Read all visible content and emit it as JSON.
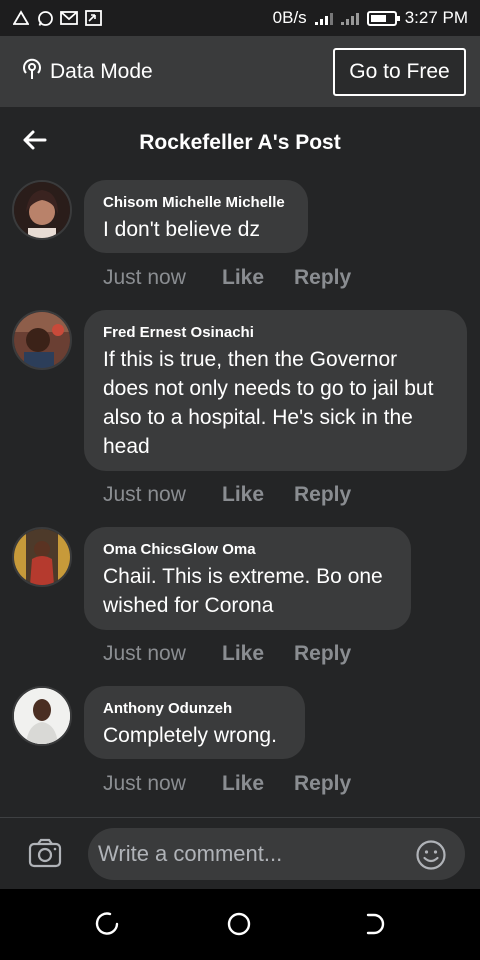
{
  "status_bar": {
    "speed": "0B/s",
    "time": "3:27 PM",
    "battery_level": 0.7,
    "icons": [
      "alert-icon",
      "whatsapp-icon",
      "gmail-icon",
      "screenshot-icon",
      "signal-icon",
      "battery-icon"
    ]
  },
  "data_bar": {
    "label": "Data Mode",
    "button": "Go to Free"
  },
  "header": {
    "title": "Rockefeller A's Post"
  },
  "comments": [
    {
      "author": "Chisom Michelle Michelle",
      "lines": [
        "I don't believe dz"
      ],
      "time": "Just now",
      "like": "Like",
      "reply": "Reply"
    },
    {
      "author": "Fred Ernest Osinachi",
      "lines": [
        "If this is true, then the Governor",
        "does not only needs to go to jail but",
        "also to a hospital. He's sick in the",
        "head"
      ],
      "time": "Just now",
      "like": "Like",
      "reply": "Reply"
    },
    {
      "author": "Oma ChicsGlow Oma",
      "lines": [
        "Chaii. This is extreme. Bo one",
        "wished for Corona"
      ],
      "time": "Just now",
      "like": "Like",
      "reply": "Reply"
    },
    {
      "author": "Anthony Odunzeh",
      "lines": [
        "Completely wrong."
      ],
      "time": "Just now",
      "like": "Like",
      "reply": "Reply"
    }
  ],
  "composer": {
    "placeholder": "Write a comment..."
  },
  "colors": {
    "background": "#242526",
    "bubble": "#3a3b3c",
    "muted": "#8a8d91"
  }
}
